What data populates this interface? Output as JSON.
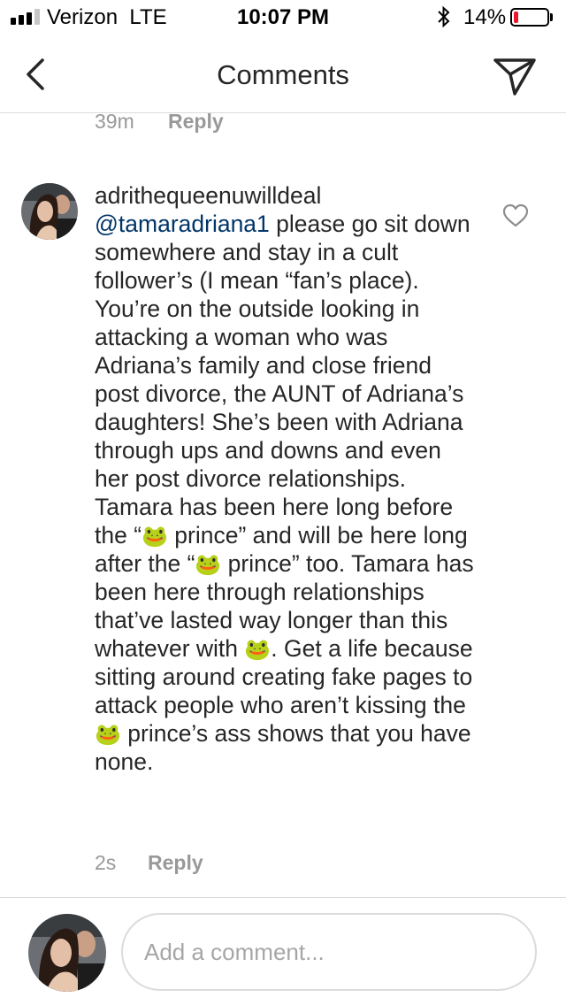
{
  "status_bar": {
    "carrier": "Verizon",
    "network": "LTE",
    "time": "10:07 PM",
    "battery_percent": "14%",
    "battery_level": 0.14,
    "signal_bars_on": 3,
    "signal_bars_total": 4,
    "battery_color": "#e8192c"
  },
  "nav": {
    "title": "Comments",
    "back_icon": "chevron-left-icon",
    "share_icon": "paper-plane-icon"
  },
  "previous_comment": {
    "time": "39m",
    "reply_label": "Reply"
  },
  "comment": {
    "username": "adrithequeenuwilldeal",
    "mention": "@tamaradriana1",
    "segments": [
      " please go sit down somewhere and stay in a cult follower’s (I mean “fan’s place). You’re on the outside looking in attacking a woman who was Adriana’s family and close friend post divorce, the AUNT of Adriana’s daughters! She’s been with Adriana through ups and downs and even her post divorce relationships. Tamara has been here long before the “",
      " prince” and will be here long after the “",
      " prince” too. Tamara has been here through relationships that’ve lasted way longer than this whatever with ",
      ". Get a life because sitting around creating fake pages to attack people who aren’t kissing the ",
      " prince’s ass shows that you have none."
    ],
    "emoji": "🐸",
    "time": "2s",
    "reply_label": "Reply",
    "like_icon": "heart-outline-icon"
  },
  "footer": {
    "placeholder": "Add a comment..."
  },
  "colors": {
    "text": "#262626",
    "mention": "#003569",
    "muted": "#999999",
    "divider": "#dbdbdb"
  }
}
